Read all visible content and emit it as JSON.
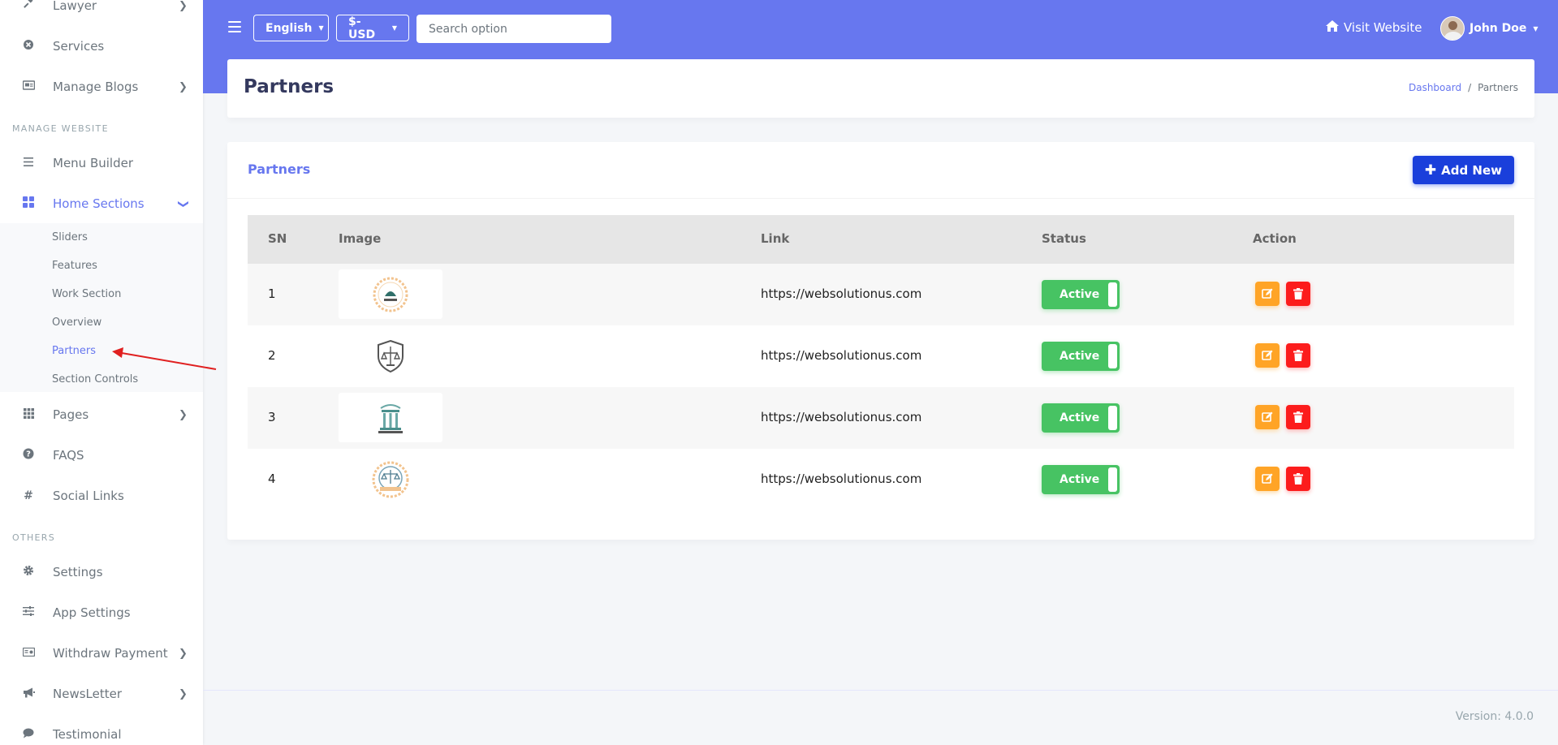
{
  "sidebar": {
    "items_top": [
      {
        "label": "Lawyer",
        "icon": "gavel-icon",
        "chevron": true
      },
      {
        "label": "Services",
        "icon": "circle-x-icon",
        "chevron": false
      },
      {
        "label": "Manage Blogs",
        "icon": "newspaper-icon",
        "chevron": true
      }
    ],
    "header_manage": "MANAGE WEBSITE",
    "menu_builder": "Menu Builder",
    "home_sections": "Home Sections",
    "sub_items": [
      "Sliders",
      "Features",
      "Work Section",
      "Overview",
      "Partners",
      "Section Controls"
    ],
    "items_mid": [
      {
        "label": "Pages",
        "icon": "grid-icon",
        "chevron": true
      },
      {
        "label": "FAQS",
        "icon": "question-circle-icon",
        "chevron": false
      },
      {
        "label": "Social Links",
        "icon": "hashtag-icon",
        "chevron": false
      }
    ],
    "header_others": "OTHERS",
    "items_bottom": [
      {
        "label": "Settings",
        "icon": "gear-icon",
        "chevron": false
      },
      {
        "label": "App Settings",
        "icon": "sliders-icon",
        "chevron": false
      },
      {
        "label": "Withdraw Payment",
        "icon": "money-icon",
        "chevron": true
      },
      {
        "label": "NewsLetter",
        "icon": "megaphone-icon",
        "chevron": true
      },
      {
        "label": "Testimonial",
        "icon": "comment-icon",
        "chevron": false
      }
    ]
  },
  "topbar": {
    "language": "English",
    "currency": "$-USD",
    "search_placeholder": "Search option",
    "visit_website": "Visit Website",
    "user_name": "John Doe"
  },
  "page": {
    "title": "Partners",
    "breadcrumb_home": "Dashboard",
    "breadcrumb_sep": "/",
    "breadcrumb_current": "Partners"
  },
  "card": {
    "title": "Partners",
    "add_new": "Add New",
    "columns": [
      "SN",
      "Image",
      "Link",
      "Status",
      "Action"
    ],
    "rows": [
      {
        "sn": "1",
        "link": "https://websolutionus.com",
        "status": "Active"
      },
      {
        "sn": "2",
        "link": "https://websolutionus.com",
        "status": "Active"
      },
      {
        "sn": "3",
        "link": "https://websolutionus.com",
        "status": "Active"
      },
      {
        "sn": "4",
        "link": "https://websolutionus.com",
        "status": "Active"
      }
    ]
  },
  "footer": {
    "version": "Version: 4.0.0"
  },
  "colors": {
    "primary": "#6777ef",
    "success": "#47c363",
    "warning": "#ffa426",
    "danger": "#fc1c1c",
    "button_blue": "#1a3fdb"
  }
}
